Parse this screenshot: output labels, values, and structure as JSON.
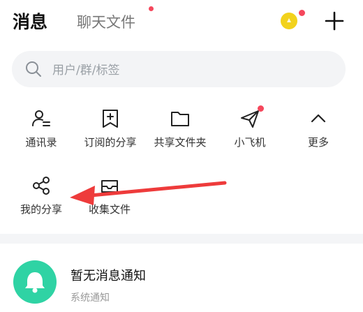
{
  "header": {
    "active_tab": "消息",
    "tab_files": "聊天文件"
  },
  "search": {
    "placeholder": "用户/群/标签"
  },
  "grid": {
    "contacts": "通讯录",
    "subscribed": "订阅的分享",
    "shared_folder": "共享文件夹",
    "plane": "小飞机",
    "more": "更多",
    "my_share": "我的分享",
    "collect": "收集文件"
  },
  "notice": {
    "title": "暂无消息通知",
    "subtitle": "系统通知"
  },
  "colors": {
    "accent_green": "#2fd3a4",
    "badge_red": "#f5475c",
    "arrow_red": "#ee3b3b"
  },
  "icons": {
    "contacts": "contacts-icon",
    "subscribed": "bookmark-plus-icon",
    "shared_folder": "folder-icon",
    "plane": "paper-plane-icon",
    "more": "chevron-up-icon",
    "my_share": "share-icon",
    "collect": "inbox-icon",
    "notice": "bell-icon"
  }
}
